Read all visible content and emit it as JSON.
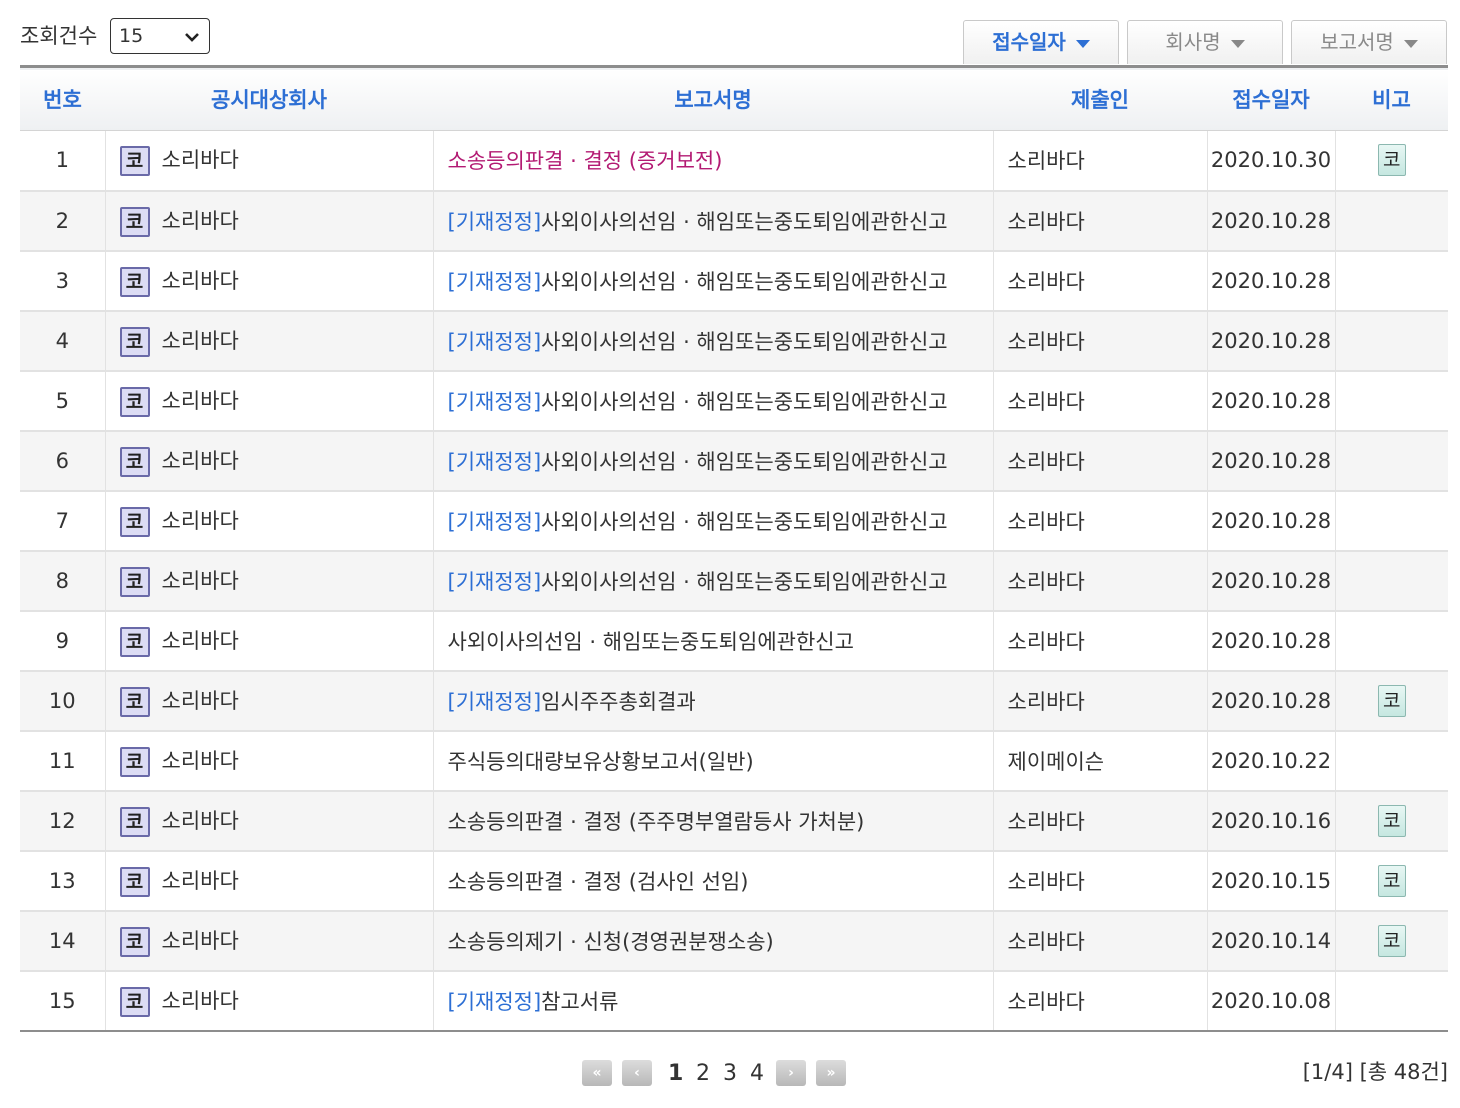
{
  "toolbar": {
    "count_label": "조회건수",
    "count_value": "15",
    "sort_buttons": [
      {
        "label": "접수일자",
        "active": true
      },
      {
        "label": "회사명",
        "active": false
      },
      {
        "label": "보고서명",
        "active": false
      }
    ]
  },
  "table": {
    "headers": [
      "번호",
      "공시대상회사",
      "보고서명",
      "제출인",
      "접수일자",
      "비고"
    ],
    "corp_icon_glyph": "코",
    "note_icon_glyph": "코",
    "rows": [
      {
        "no": "1",
        "company": "소리바다",
        "tag": "",
        "title": "소송등의판결 · 결정 (증거보전)",
        "title_style": "red",
        "submitter": "소리바다",
        "date": "2020.10.30",
        "note": "코"
      },
      {
        "no": "2",
        "company": "소리바다",
        "tag": "[기재정정]",
        "title": "사외이사의선임 · 해임또는중도퇴임에관한신고",
        "title_style": "plain",
        "submitter": "소리바다",
        "date": "2020.10.28",
        "note": ""
      },
      {
        "no": "3",
        "company": "소리바다",
        "tag": "[기재정정]",
        "title": "사외이사의선임 · 해임또는중도퇴임에관한신고",
        "title_style": "plain",
        "submitter": "소리바다",
        "date": "2020.10.28",
        "note": ""
      },
      {
        "no": "4",
        "company": "소리바다",
        "tag": "[기재정정]",
        "title": "사외이사의선임 · 해임또는중도퇴임에관한신고",
        "title_style": "plain",
        "submitter": "소리바다",
        "date": "2020.10.28",
        "note": ""
      },
      {
        "no": "5",
        "company": "소리바다",
        "tag": "[기재정정]",
        "title": "사외이사의선임 · 해임또는중도퇴임에관한신고",
        "title_style": "plain",
        "submitter": "소리바다",
        "date": "2020.10.28",
        "note": ""
      },
      {
        "no": "6",
        "company": "소리바다",
        "tag": "[기재정정]",
        "title": "사외이사의선임 · 해임또는중도퇴임에관한신고",
        "title_style": "plain",
        "submitter": "소리바다",
        "date": "2020.10.28",
        "note": ""
      },
      {
        "no": "7",
        "company": "소리바다",
        "tag": "[기재정정]",
        "title": "사외이사의선임 · 해임또는중도퇴임에관한신고",
        "title_style": "plain",
        "submitter": "소리바다",
        "date": "2020.10.28",
        "note": ""
      },
      {
        "no": "8",
        "company": "소리바다",
        "tag": "[기재정정]",
        "title": "사외이사의선임 · 해임또는중도퇴임에관한신고",
        "title_style": "plain",
        "submitter": "소리바다",
        "date": "2020.10.28",
        "note": ""
      },
      {
        "no": "9",
        "company": "소리바다",
        "tag": "",
        "title": "사외이사의선임 · 해임또는중도퇴임에관한신고",
        "title_style": "plain",
        "submitter": "소리바다",
        "date": "2020.10.28",
        "note": ""
      },
      {
        "no": "10",
        "company": "소리바다",
        "tag": "[기재정정]",
        "title": "임시주주총회결과",
        "title_style": "plain",
        "submitter": "소리바다",
        "date": "2020.10.28",
        "note": "코"
      },
      {
        "no": "11",
        "company": "소리바다",
        "tag": "",
        "title": "주식등의대량보유상황보고서(일반)",
        "title_style": "plain",
        "submitter": "제이메이슨",
        "date": "2020.10.22",
        "note": ""
      },
      {
        "no": "12",
        "company": "소리바다",
        "tag": "",
        "title": "소송등의판결 · 결정 (주주명부열람등사 가처분)",
        "title_style": "plain",
        "submitter": "소리바다",
        "date": "2020.10.16",
        "note": "코"
      },
      {
        "no": "13",
        "company": "소리바다",
        "tag": "",
        "title": "소송등의판결 · 결정 (검사인 선임)",
        "title_style": "plain",
        "submitter": "소리바다",
        "date": "2020.10.15",
        "note": "코"
      },
      {
        "no": "14",
        "company": "소리바다",
        "tag": "",
        "title": "소송등의제기 · 신청(경영권분쟁소송)",
        "title_style": "plain",
        "submitter": "소리바다",
        "date": "2020.10.14",
        "note": "코"
      },
      {
        "no": "15",
        "company": "소리바다",
        "tag": "[기재정정]",
        "title": "참고서류",
        "title_style": "plain",
        "submitter": "소리바다",
        "date": "2020.10.08",
        "note": ""
      }
    ]
  },
  "pagination": {
    "first_glyph": "«",
    "prev_glyph": "‹",
    "next_glyph": "›",
    "last_glyph": "»",
    "pages": [
      "1",
      "2",
      "3",
      "4"
    ],
    "current": "1",
    "summary": "[1/4] [총 48건]"
  },
  "colors": {
    "accent": "#2d6fd4",
    "highlight_title": "#b31a73"
  }
}
